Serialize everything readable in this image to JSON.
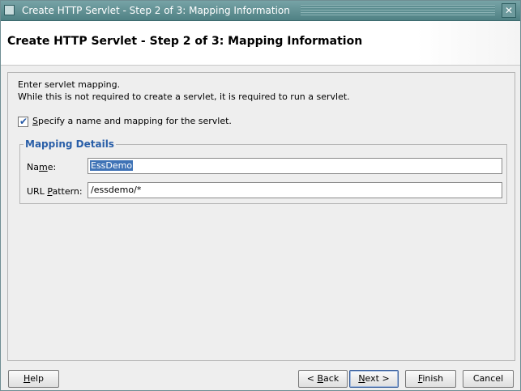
{
  "window": {
    "title": "Create HTTP Servlet - Step 2 of 3: Mapping Information",
    "close_glyph": "✕"
  },
  "header": {
    "title": "Create HTTP Servlet - Step 2 of 3: Mapping Information"
  },
  "main": {
    "intro_line1": "Enter servlet mapping.",
    "intro_line2": "While this is not required to create a servlet, it is required to run a servlet.",
    "checkbox": {
      "label_pre": "",
      "label_mnemonic": "S",
      "label_post": "pecify a name and mapping for the servlet.",
      "checked": true
    },
    "mapping": {
      "legend": "Mapping Details",
      "name_label_pre": "Na",
      "name_label_mnemonic": "m",
      "name_label_post": "e:",
      "name_value": "EssDemo",
      "url_label_pre": "URL ",
      "url_label_mnemonic": "P",
      "url_label_post": "attern:",
      "url_value": "/essdemo/*"
    }
  },
  "buttons": {
    "help_mn": "H",
    "help_rest": "elp",
    "back_pre": "< ",
    "back_mn": "B",
    "back_rest": "ack",
    "next_mn": "N",
    "next_rest": "ext >",
    "finish_mn": "F",
    "finish_rest": "inish",
    "cancel": "Cancel"
  },
  "colors": {
    "titlebar": "#5f8f92",
    "accent_blue": "#2a5fa8",
    "selection": "#3f73b6"
  }
}
